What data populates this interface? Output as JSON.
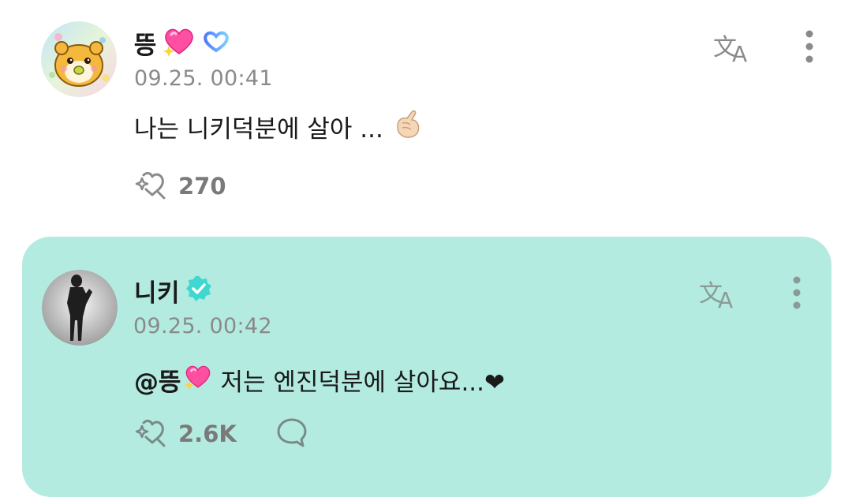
{
  "post": {
    "author": {
      "name": "뜽",
      "heart_icon": "sparkling-heart-icon",
      "badge_icon": "weverse-badge-icon"
    },
    "timestamp": "09.25. 00:41",
    "text": "나는 니키덕분에 살아 ...",
    "text_emoji": "finger-heart-emoji",
    "like_count": "270",
    "icons": {
      "translate": "translate-icon",
      "more": "kebab-menu-icon",
      "like": "like-icon"
    }
  },
  "reply": {
    "author": {
      "name": "니키",
      "verified_icon": "verified-badge-icon"
    },
    "timestamp": "09.25. 00:42",
    "mention": "@뜽",
    "text": "저는 엔진덕분에 살아요...❤",
    "like_count": "2.6K",
    "icons": {
      "translate": "translate-icon",
      "more": "kebab-menu-icon",
      "like": "like-icon",
      "comment": "comment-bubble-icon"
    }
  },
  "colors": {
    "reply_background": "#b4ebe0",
    "verified_badge": "#3fd7cf",
    "timestamp": "#8a8a8a",
    "count": "#7a7a7a",
    "heart_pink": "#ff4fa3"
  }
}
